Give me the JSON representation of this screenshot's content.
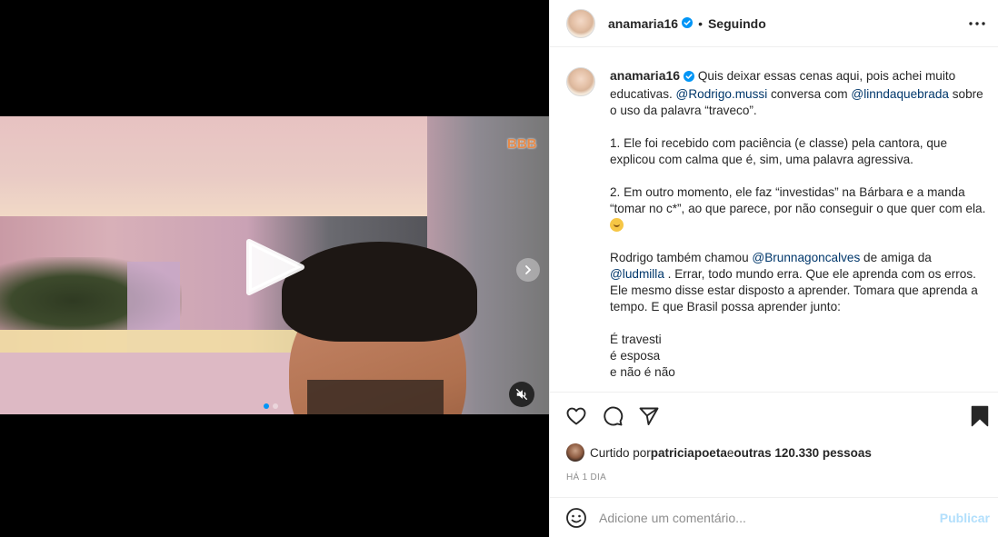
{
  "header": {
    "username": "anamaria16",
    "separator": "•",
    "follow_status": "Seguindo",
    "more_icon": "more-horizontal-icon"
  },
  "media": {
    "brand_tag": "BBB",
    "play_icon": "play-icon",
    "next_icon": "chevron-right-icon",
    "mute_icon": "speaker-muted-icon",
    "carousel_total": 2,
    "carousel_active": 1
  },
  "caption": {
    "username": "anamaria16",
    "p1_a": " Quis deixar essas cenas aqui, pois achei muito educativas. ",
    "p1_mention1": "@Rodrigo.mussi",
    "p1_b": " conversa com ",
    "p1_mention2": "@linndaquebrada",
    "p1_c": " sobre o uso da palavra “traveco”.",
    "p2": "1. Ele foi recebido com paciência (e classe) pela cantora, que explicou com calma que é, sim, uma palavra agressiva.",
    "p3": "2. Em outro momento, ele faz “investidas” na Bárbara e a manda “tomar no c*”, ao que parece, por não conseguir o que quer com ela. ",
    "p4_a": "Rodrigo também chamou ",
    "p4_mention1": "@Brunnagoncalves",
    "p4_b": " de amiga da ",
    "p4_mention2": "@ludmilla",
    "p4_c": " . Errar, todo mundo erra. Que ele aprenda com os erros. Ele mesmo disse estar disposto a aprender. Tomara que aprenda a tempo. E que Brasil possa aprender junto:",
    "p5_line1": "É travesti",
    "p5_line2": "é esposa",
    "p5_line3": "e não é não"
  },
  "actions": {
    "like_icon": "heart-icon",
    "comment_icon": "comment-icon",
    "share_icon": "send-icon",
    "save_icon": "bookmark-icon"
  },
  "likes": {
    "prefix": "Curtido por ",
    "liker": "patriciapoeta",
    "middle": " e ",
    "others": "outras 120.330 pessoas"
  },
  "timestamp": "HÁ 1 DIA",
  "comment": {
    "placeholder": "Adicione um comentário...",
    "publish_label": "Publicar",
    "emoji_icon": "smiley-icon"
  },
  "colors": {
    "link": "#00376b",
    "verified": "#0095f6",
    "publish_disabled": "#b2dffc",
    "muted_text": "#8e8e8e"
  }
}
